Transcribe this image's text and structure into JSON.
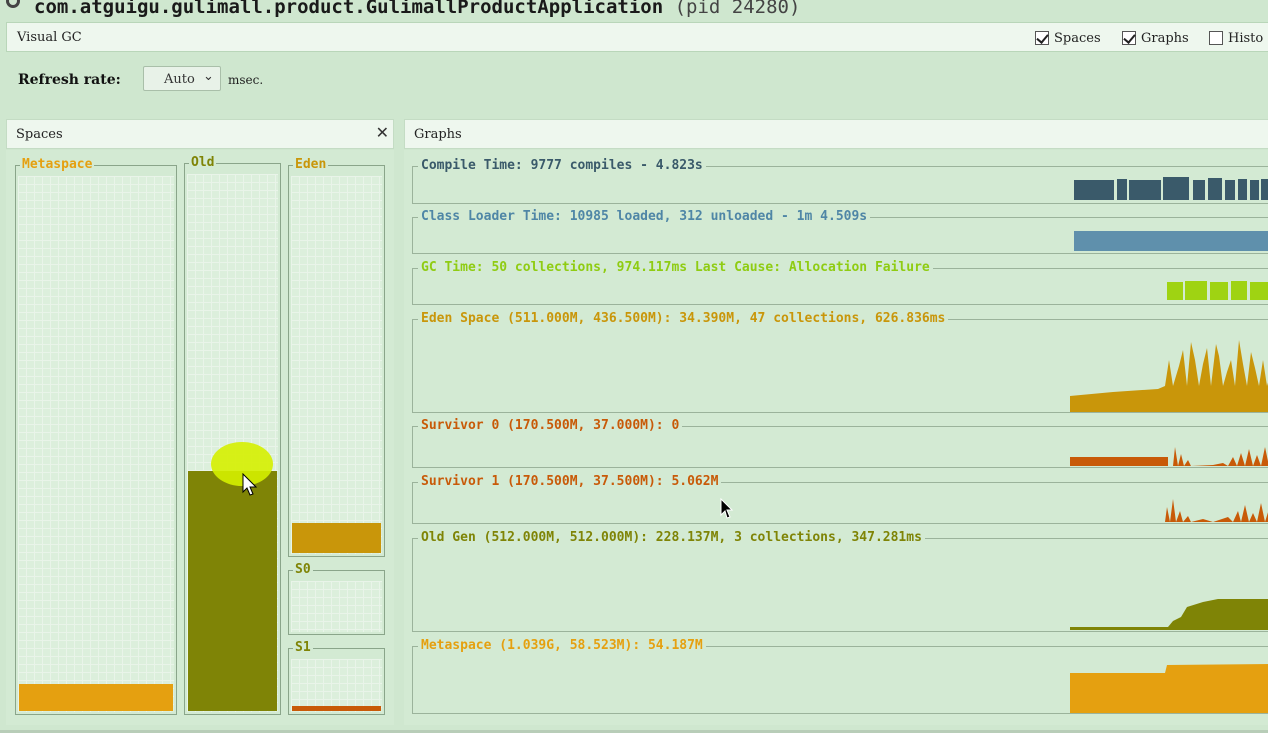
{
  "window": {
    "title": "com.atguigu.gulimall.product.GulimallProductApplication",
    "pid": "(pid 24280)",
    "icon": "loading-icon"
  },
  "tab": {
    "label": "Visual GC"
  },
  "toggles": [
    {
      "label": "Spaces",
      "checked": true
    },
    {
      "label": "Graphs",
      "checked": true
    },
    {
      "label": "Histo",
      "checked": false
    }
  ],
  "refresh": {
    "label": "Refresh rate:",
    "value": "Auto",
    "unit": "msec."
  },
  "spaces_panel": {
    "title": "Spaces",
    "close_icon": "close-icon",
    "spaces": [
      {
        "key": "metaspace",
        "label": "Metaspace",
        "color": "#e5a010",
        "fill_fraction": 0.05
      },
      {
        "key": "old",
        "label": "Old",
        "color": "#7f8406",
        "fill_fraction": 0.45
      },
      {
        "key": "eden",
        "label": "Eden",
        "color": "#c9960a",
        "fill_fraction": 0.08
      },
      {
        "key": "s0",
        "label": "S0",
        "color": "#c85a08",
        "fill_fraction": 0.0
      },
      {
        "key": "s1",
        "label": "S1",
        "color": "#c85a08",
        "fill_fraction": 0.1
      }
    ]
  },
  "graphs_panel": {
    "title": "Graphs",
    "graphs": [
      {
        "key": "compile",
        "label": "Compile Time: 9777 compiles - 4.823s",
        "color": "#3a5a6a"
      },
      {
        "key": "classloader",
        "label": "Class Loader Time: 10985 loaded, 312 unloaded - 1m 4.509s",
        "color": "#4f86a6"
      },
      {
        "key": "gc",
        "label": "GC Time: 50 collections, 974.117ms Last Cause: Allocation Failure",
        "color": "#8fcc12"
      },
      {
        "key": "eden",
        "label": "Eden Space (511.000M, 436.500M): 34.390M, 47 collections, 626.836ms",
        "color": "#c9960a"
      },
      {
        "key": "s0",
        "label": "Survivor 0 (170.500M, 37.000M): 0",
        "color": "#c85a08"
      },
      {
        "key": "s1",
        "label": "Survivor 1 (170.500M, 37.500M): 5.062M",
        "color": "#c85a08"
      },
      {
        "key": "oldgen",
        "label": "Old Gen (512.000M, 512.000M): 228.137M, 3 collections, 347.281ms",
        "color": "#7f8406"
      },
      {
        "key": "metaspace",
        "label": "Metaspace (1.039G, 58.523M): 54.187M",
        "color": "#e5a010"
      }
    ]
  }
}
